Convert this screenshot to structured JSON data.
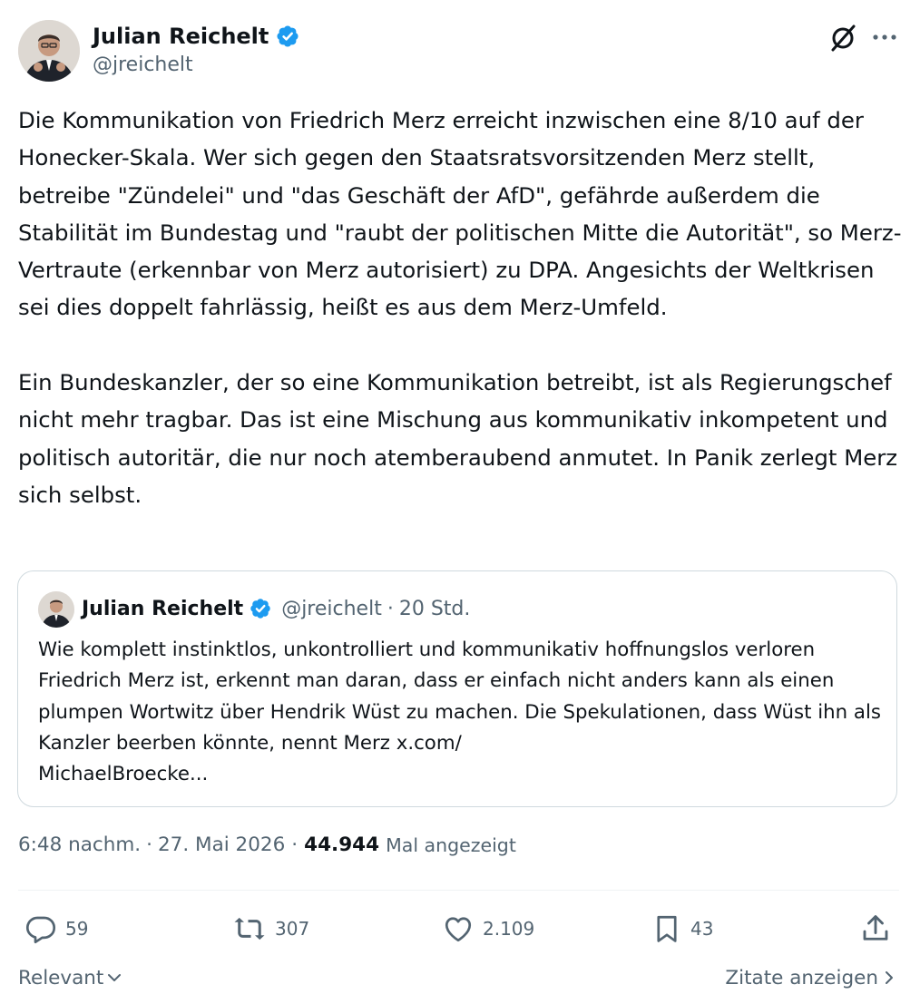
{
  "author": {
    "name": "Julian Reichelt",
    "handle": "@jreichelt",
    "verified_color": "#1d9bf0"
  },
  "tweet": {
    "text": "Die Kommunikation von Friedrich Merz erreicht inzwischen eine 8/10 auf der Honecker-Skala. Wer sich gegen den Staatsratsvorsitzenden Merz stellt, betreibe \"Zündelei\" und \"das Geschäft der AfD\", gefährde außerdem die Stabilität im Bundestag und \"raubt der politischen Mitte die Autorität\", so Merz-Vertraute (erkennbar von Merz autorisiert) zu DPA. Angesichts der Weltkrisen sei dies doppelt fahrlässig, heißt es aus dem Merz-Umfeld.\n\nEin Bundeskanzler, der so eine Kommunikation betreibt, ist als Regierungschef nicht mehr tragbar. Das ist eine Mischung aus kommunikativ inkompetent und politisch autoritär, die nur noch atemberaubend anmutet. In Panik zerlegt Merz sich selbst."
  },
  "quote": {
    "name": "Julian Reichelt",
    "handle": "@jreichelt",
    "separator": "·",
    "time": "20 Std.",
    "text": "Wie komplett instinktlos, unkontrolliert und kommunikativ hoffnungslos verloren Friedrich Merz ist, erkennt man daran, dass er einfach nicht anders kann als einen plumpen Wortwitz über Hendrik Wüst zu machen. Die Spekulationen, dass Wüst ihn als Kanzler beerben könnte, nennt Merz x.com/\nMichaelBroecke..."
  },
  "meta": {
    "time": "6:48 nachm.",
    "sep1": "·",
    "date": "27. Mai 2026",
    "sep2": "·",
    "views": "44.944",
    "views_label": "Mal angezeigt"
  },
  "actions": {
    "replies": "59",
    "reposts": "307",
    "likes": "2.109",
    "bookmarks": "43"
  },
  "footer": {
    "sort_label": "Relevant",
    "quotes_link": "Zitate anzeigen"
  },
  "icons": {
    "grok": "grok-icon",
    "more": "more-icon",
    "reply": "reply-icon",
    "repost": "repost-icon",
    "like": "heart-icon",
    "bookmark": "bookmark-icon",
    "share": "share-icon",
    "verified": "verified-badge-icon"
  }
}
